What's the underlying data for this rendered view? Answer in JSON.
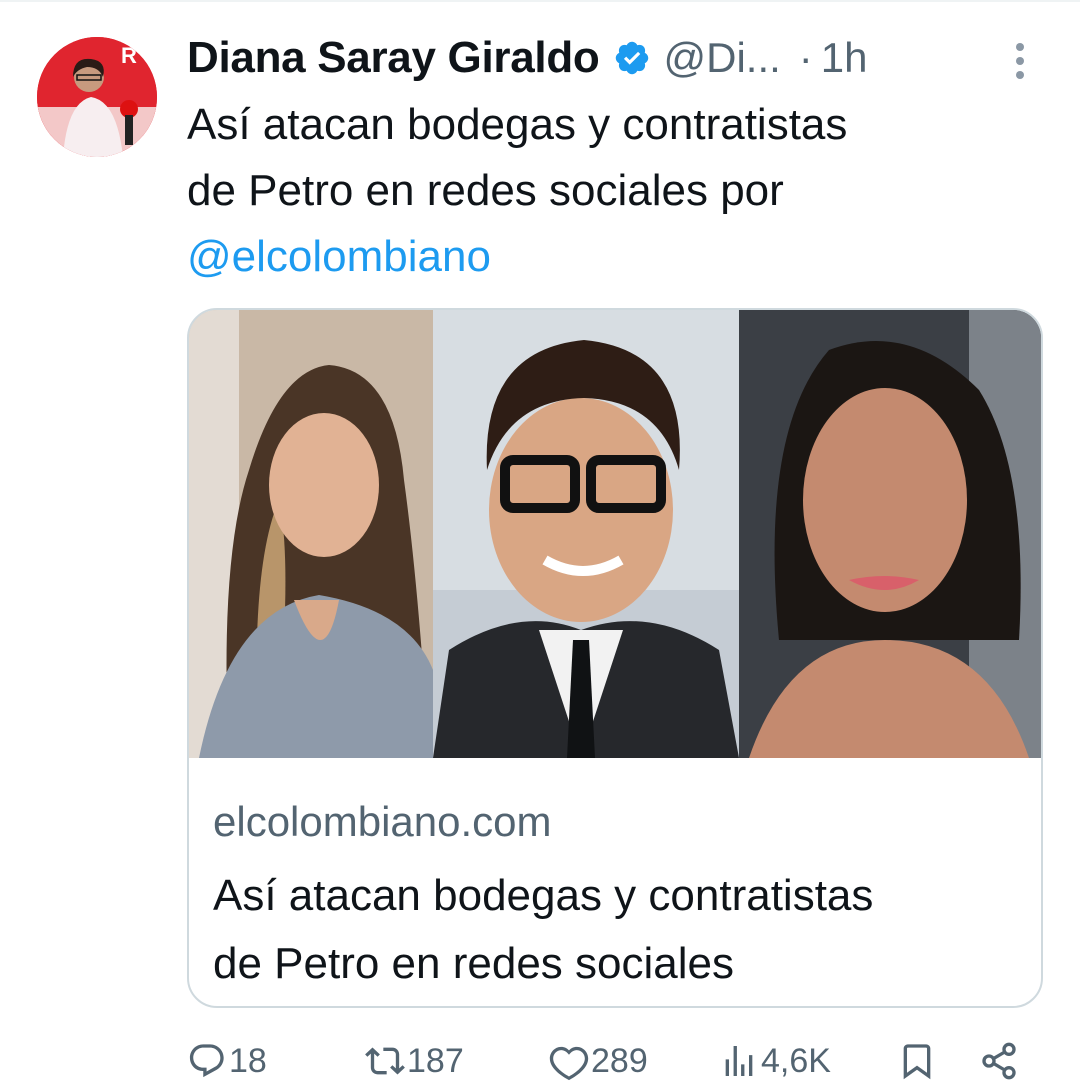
{
  "tweet": {
    "author_name": "Diana Saray Giraldo",
    "handle": "@Di...",
    "separator": "·",
    "time": "1h",
    "text_lines": [
      "Así atacan bodegas y contratistas",
      "de Petro en redes sociales por"
    ],
    "mention": "@elcolombiano"
  },
  "card": {
    "domain": "elcolombiano.com",
    "title_lines": [
      "Así atacan bodegas y contratistas",
      "de Petro en redes sociales"
    ]
  },
  "actions": {
    "replies": "18",
    "retweets": "187",
    "likes": "289",
    "views": "4,6K"
  },
  "icons": [
    "verified-badge-icon",
    "more-options-icon",
    "reply-icon",
    "retweet-icon",
    "like-icon",
    "views-icon",
    "bookmark-icon",
    "share-icon"
  ],
  "colors": {
    "text": "#0f1419",
    "secondary": "#536471",
    "link": "#1d9bf0",
    "border": "#cfd9de",
    "verified": "#1d9bf0"
  }
}
